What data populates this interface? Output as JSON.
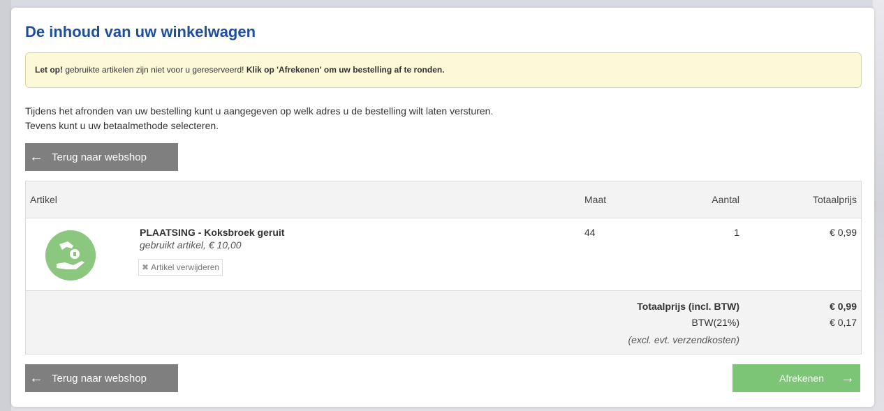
{
  "page": {
    "title": "De inhoud van uw winkelwagen"
  },
  "alert": {
    "prefix": "Let op!",
    "text": " gebruikte artikelen zijn niet voor u gereserveerd! ",
    "emphasis": "Klik op 'Afrekenen' om uw bestelling af te ronden."
  },
  "info": {
    "line1": "Tijdens het afronden van uw bestelling kunt u aangegeven op welk adres u de bestelling wilt laten versturen.",
    "line2": "Tevens kunt u uw betaalmethode selecteren."
  },
  "buttons": {
    "back_label": "Terug naar webshop",
    "checkout_label": "Afrekenen"
  },
  "table": {
    "headers": {
      "artikel": "Artikel",
      "maat": "Maat",
      "aantal": "Aantal",
      "totaalprijs": "Totaalprijs"
    },
    "rows": [
      {
        "name": "PLAATSING - Koksbroek geruit",
        "subtitle": "gebruikt artikel, € 10,00",
        "remove_label": "Artikel verwijderen",
        "maat": "44",
        "aantal": "1",
        "prijs": "€ 0,99",
        "icon": "hand-coin-icon"
      }
    ]
  },
  "totals": {
    "incl_label": "Totaalprijs (incl. BTW)",
    "incl_value": "€ 0,99",
    "btw_label": "BTW(21%)",
    "btw_value": "€ 0,17",
    "note": "(excl. evt. verzendkosten)"
  },
  "colors": {
    "title": "#1f4f9c",
    "alert_bg": "#fbf9d8",
    "back_button": "#7f7f7f",
    "checkout_button": "#7cc476",
    "product_icon_bg": "#8cc77f"
  }
}
